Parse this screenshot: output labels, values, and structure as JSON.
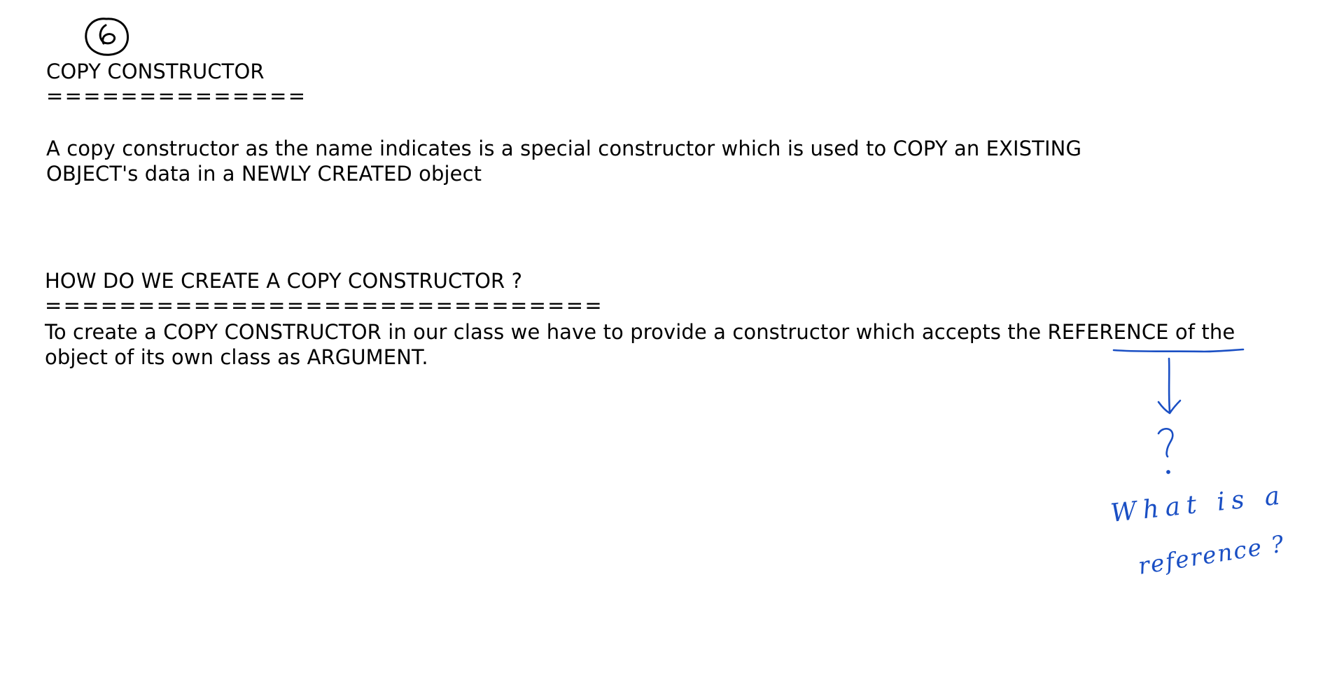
{
  "page": {
    "page_number": "6"
  },
  "section1": {
    "heading": "COPY CONSTRUCTOR",
    "underline": "==============",
    "line1": "A copy constructor as the name indicates is a special constructor which is used to COPY an EXISTING",
    "line2": "OBJECT's data in a NEWLY CREATED object"
  },
  "section2": {
    "heading": "HOW DO WE CREATE A COPY CONSTRUCTOR ?",
    "underline": "==============================",
    "line1_before": "To create a COPY CONSTRUCTOR in our class we have to provide a constructor which accepts the ",
    "line1_highlight": "REFERENCE",
    "line1_after": " of the",
    "line2": "object of its own class as ARGUMENT."
  },
  "annotation": {
    "ink_color": "#1a4fc4",
    "question_mark": "?",
    "note_line1": "What is a",
    "note_line2": "reference ?"
  }
}
